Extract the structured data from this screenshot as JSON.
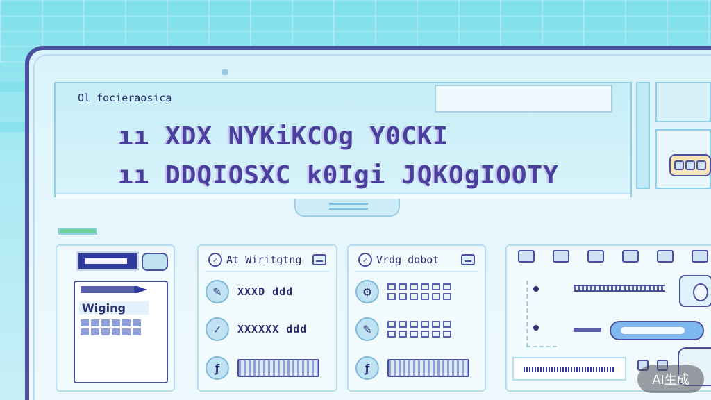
{
  "header": {
    "app_label": "Ol focieraosica",
    "headline_line_1": "ıı  XDX  NYKiKCOg Y0CKI",
    "headline_line_2": "ıı  DDQIOSXC  k0Igi  JQKOgIOOTY"
  },
  "cards": [
    {
      "doc_label": "Wiging"
    },
    {
      "title": "At Wiritgtng",
      "rows": [
        {
          "icon": "wrench-icon",
          "text": "XXXD  ddd"
        },
        {
          "icon": "check-icon",
          "text": "XXXXXX  ddd"
        },
        {
          "icon": "function-icon",
          "text": ""
        }
      ]
    },
    {
      "title": "Vrdg dobot",
      "rows": [
        {
          "icon": "settings-icon",
          "text": ""
        },
        {
          "icon": "tool-icon",
          "text": ""
        },
        {
          "icon": "function-icon",
          "text": ""
        }
      ]
    }
  ],
  "badge": {
    "label": "AI生成"
  },
  "colors": {
    "frame": "#4a4f9e",
    "headline": "#4a3f9c",
    "accent_green": "#6fd49a",
    "pill_blue": "#7fb9f0"
  }
}
